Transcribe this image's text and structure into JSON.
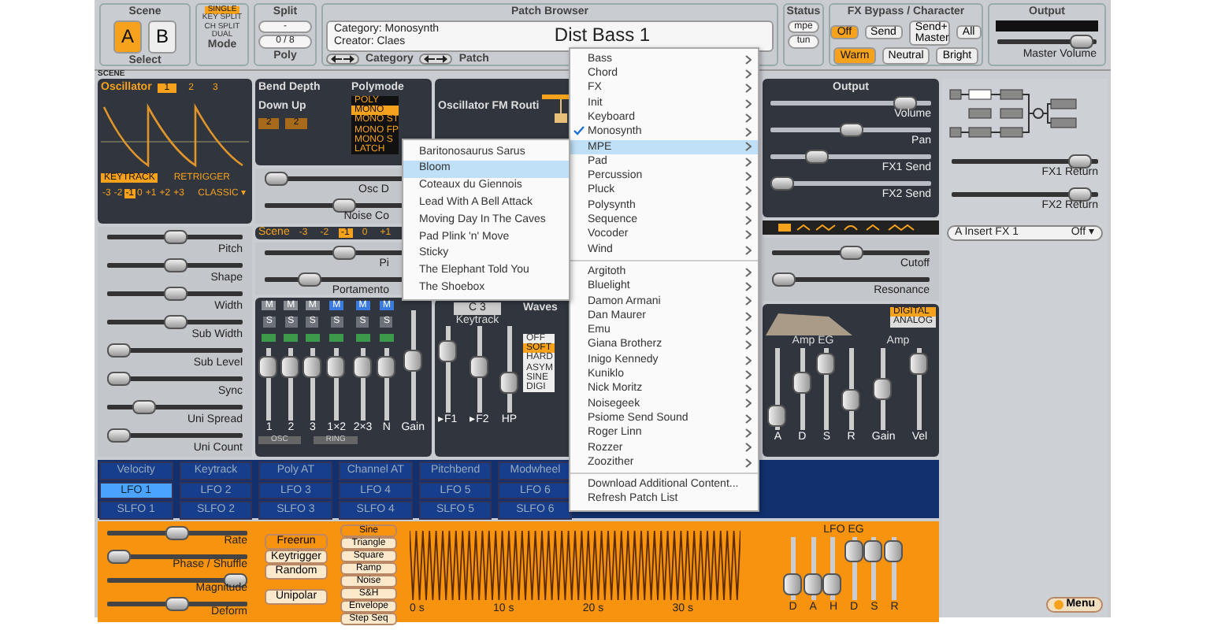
{
  "header": {
    "scene": {
      "title": "Scene",
      "buttons": [
        {
          "label": "A",
          "selected": true
        },
        {
          "label": "B",
          "selected": false
        }
      ],
      "label": "Select"
    },
    "mode": {
      "options": [
        {
          "label": "SINGLE",
          "selected": true
        },
        {
          "label": "KEY SPLIT",
          "selected": false
        },
        {
          "label": "CH SPLIT",
          "selected": false
        },
        {
          "label": "DUAL",
          "selected": false
        }
      ],
      "label": "Mode"
    },
    "split": {
      "title": "Split",
      "value": "-",
      "poly": "0 / 8",
      "label": "Poly"
    },
    "patch_browser": {
      "title": "Patch Browser",
      "category": "Category: Monosynth",
      "creator": "Creator: Claes",
      "patch_name": "Dist Bass 1",
      "category_nav": "Category",
      "patch_nav": "Patch"
    },
    "status": {
      "title": "Status",
      "buttons": [
        "mpe",
        "tun"
      ]
    },
    "fx_bypass": {
      "title": "FX Bypass / Character",
      "buttons": [
        {
          "label": "Off",
          "selected": true
        },
        {
          "label": "Send",
          "selected": false
        },
        {
          "label": "Send+ Master",
          "selected": false
        },
        {
          "label": "All",
          "selected": false
        }
      ],
      "character": [
        {
          "label": "Warm",
          "selected": true
        },
        {
          "label": "Neutral",
          "selected": false
        },
        {
          "label": "Bright",
          "selected": false
        }
      ]
    },
    "output": {
      "title": "Output",
      "master_volume": {
        "label": "Master Volume",
        "level": 0.95
      }
    }
  },
  "scene_label": "SCENE",
  "oscillator": {
    "title": "Oscillator",
    "tabs": [
      {
        "label": "1",
        "selected": true
      },
      {
        "label": "2",
        "selected": false
      },
      {
        "label": "3",
        "selected": false
      }
    ],
    "toggles": [
      {
        "label": "KEYTRACK",
        "on": true
      },
      {
        "label": "RETRIGGER",
        "on": false
      }
    ],
    "octave": [
      {
        "label": "-3",
        "selected": false
      },
      {
        "label": "-2",
        "selected": false
      },
      {
        "label": "-1",
        "selected": true
      },
      {
        "label": "0",
        "selected": false
      },
      {
        "label": "+1",
        "selected": false
      },
      {
        "label": "+2",
        "selected": false
      },
      {
        "label": "+3",
        "selected": false
      }
    ],
    "type": "CLASSIC ▾",
    "sliders": [
      {
        "label": "Pitch",
        "level": 0.5
      },
      {
        "label": "Shape",
        "level": 0.5
      },
      {
        "label": "Width",
        "level": 0.5
      },
      {
        "label": "Sub Width",
        "level": 0.5
      },
      {
        "label": "Sub Level",
        "level": 0
      },
      {
        "label": "Sync",
        "level": 0
      },
      {
        "label": "Uni Spread",
        "level": 0.22
      },
      {
        "label": "Uni Count",
        "level": 0
      }
    ]
  },
  "bend_depth": {
    "title": "Bend Depth",
    "label": "Down Up",
    "values": [
      "2",
      "2"
    ]
  },
  "polymode": {
    "title": "Polymode",
    "options": [
      {
        "label": "POLY",
        "selected": false
      },
      {
        "label": "MONO",
        "selected": true
      },
      {
        "label": "MONO ST",
        "selected": false
      },
      {
        "label": "MONO FP",
        "selected": false
      },
      {
        "label": "MONO S",
        "selected": false
      },
      {
        "label": "LATCH",
        "selected": false
      }
    ]
  },
  "osc_drift": {
    "label": "Osc D",
    "level": 0
  },
  "noise_color": {
    "label": "Noise Co",
    "level": 0.5
  },
  "scene_octave": {
    "title": "Scene",
    "options": [
      {
        "label": "-3",
        "selected": false
      },
      {
        "label": "-2",
        "selected": false
      },
      {
        "label": "-1",
        "selected": true
      },
      {
        "label": "0",
        "selected": false
      },
      {
        "label": "+1",
        "selected": false
      }
    ]
  },
  "scene_pitch": {
    "label": "Pi",
    "level": 0.5
  },
  "portamento": {
    "label": "Portamento",
    "level": 0.25
  },
  "mixer": {
    "channels": [
      {
        "label": "1",
        "mute_label": "M",
        "solo_label": "S",
        "muted": false,
        "level": 0.85
      },
      {
        "label": "2",
        "mute_label": "M",
        "solo_label": "S",
        "muted": false,
        "level": 0.85
      },
      {
        "label": "3",
        "mute_label": "M",
        "solo_label": "S",
        "muted": false,
        "level": 0.85
      },
      {
        "label": "1×2",
        "mute_label": "M",
        "solo_label": "S",
        "muted": true,
        "level": 0.85
      },
      {
        "label": "2×3",
        "mute_label": "M",
        "solo_label": "S",
        "muted": true,
        "level": 0.85
      },
      {
        "label": "N",
        "mute_label": "M",
        "solo_label": "S",
        "muted": true,
        "level": 0.85
      },
      {
        "label": "Gain",
        "level": 0.55
      }
    ],
    "groups": [
      "OSC",
      "RING"
    ]
  },
  "filter": {
    "fm_title": "Oscillator FM Routi",
    "note": "C 3",
    "keytrack": "Keytrack",
    "sliders": [
      {
        "label": "▸F1",
        "level": 0.8
      },
      {
        "label": "▸F2",
        "level": 0.55
      },
      {
        "label": "HP",
        "level": 0.3
      }
    ],
    "waveshaper": {
      "title": "Waves",
      "options": [
        {
          "label": "OFF",
          "selected": false
        },
        {
          "label": "SOFT",
          "selected": true
        },
        {
          "label": "HARD",
          "selected": false
        },
        {
          "label": "ASYM",
          "selected": false
        },
        {
          "label": "SINE",
          "selected": false
        },
        {
          "label": "DIGI",
          "selected": false
        }
      ]
    }
  },
  "output_panel": {
    "title": "Output",
    "sliders": [
      {
        "label": "Volume",
        "level": 0.9
      },
      {
        "label": "Pan",
        "level": 0.5
      },
      {
        "label": "FX1 Send",
        "level": 0.25
      },
      {
        "label": "FX2 Send",
        "level": 0
      }
    ]
  },
  "filter_controls": {
    "sliders": [
      {
        "label": "Cutoff",
        "level": 0.5
      },
      {
        "label": "Resonance",
        "level": 0
      }
    ]
  },
  "amp_eg": {
    "title": "Amp EG",
    "amp_title": "Amp",
    "modes": [
      {
        "label": "DIGITAL",
        "selected": true
      },
      {
        "label": "ANALOG",
        "selected": false
      }
    ],
    "sliders": [
      {
        "label": "A",
        "level": 0.05
      },
      {
        "label": "D",
        "level": 0.6
      },
      {
        "label": "S",
        "level": 0.92
      },
      {
        "label": "R",
        "level": 0.3
      },
      {
        "label": "Gain",
        "level": 0.5
      },
      {
        "label": "Vel",
        "level": 0.92
      }
    ]
  },
  "fx_panel": {
    "returns": [
      {
        "label": "FX1 Return",
        "level": 0.95
      },
      {
        "label": "FX2 Return",
        "level": 0.95
      }
    ],
    "insert": {
      "label": "A Insert FX 1",
      "value": "Off ▾"
    }
  },
  "modulation": {
    "rows": [
      [
        {
          "label": "Velocity",
          "selected": false
        },
        {
          "label": "Keytrack",
          "selected": false
        },
        {
          "label": "Poly AT",
          "selected": false
        },
        {
          "label": "Channel AT",
          "selected": false
        },
        {
          "label": "Pitchbend",
          "selected": false
        },
        {
          "label": "Modwheel",
          "selected": false
        }
      ],
      [
        {
          "label": "LFO 1",
          "selected": true
        },
        {
          "label": "LFO 2",
          "selected": false
        },
        {
          "label": "LFO 3",
          "selected": false
        },
        {
          "label": "LFO 4",
          "selected": false
        },
        {
          "label": "LFO 5",
          "selected": false
        },
        {
          "label": "LFO 6",
          "selected": false
        }
      ],
      [
        {
          "label": "SLFO 1",
          "selected": false
        },
        {
          "label": "SLFO 2",
          "selected": false
        },
        {
          "label": "SLFO 3",
          "selected": false
        },
        {
          "label": "SLFO 4",
          "selected": false
        },
        {
          "label": "SLFO 5",
          "selected": false
        },
        {
          "label": "SLFO 6",
          "selected": false
        }
      ]
    ]
  },
  "lfo": {
    "sliders": [
      {
        "label": "Rate",
        "level": 0.5
      },
      {
        "label": "Phase / Shuffle",
        "level": 0
      },
      {
        "label": "Magnitude",
        "level": 1
      },
      {
        "label": "Deform",
        "level": 0.5
      }
    ],
    "triggers": [
      {
        "label": "Freerun",
        "selected": true
      },
      {
        "label": "Keytrigger",
        "selected": false
      },
      {
        "label": "Random",
        "selected": false
      }
    ],
    "unipolar": {
      "label": "Unipolar",
      "on": false
    },
    "shapes": [
      {
        "label": "Sine",
        "selected": true
      },
      {
        "label": "Triangle",
        "selected": false
      },
      {
        "label": "Square",
        "selected": false
      },
      {
        "label": "Ramp",
        "selected": false
      },
      {
        "label": "Noise",
        "selected": false
      },
      {
        "label": "S&H",
        "selected": false
      },
      {
        "label": "Envelope",
        "selected": false
      },
      {
        "label": "Step Seq",
        "selected": false
      }
    ],
    "time_ticks": [
      "0 s",
      "10 s",
      "20 s",
      "30 s"
    ],
    "eg": {
      "title": "LFO EG",
      "sliders": [
        {
          "label": "D",
          "level": 0.1
        },
        {
          "label": "A",
          "level": 0.1
        },
        {
          "label": "H",
          "level": 0.1
        },
        {
          "label": "D",
          "level": 0.9
        },
        {
          "label": "S",
          "level": 0.9
        },
        {
          "label": "R",
          "level": 0.9
        }
      ]
    }
  },
  "menu_button": "Menu",
  "category_menu": {
    "sections": [
      [
        {
          "label": "Bass",
          "checked": false,
          "selected": false,
          "submenu": true
        },
        {
          "label": "Chord",
          "checked": false,
          "selected": false,
          "submenu": true
        },
        {
          "label": "FX",
          "checked": false,
          "selected": false,
          "submenu": true
        },
        {
          "label": "Init",
          "checked": false,
          "selected": false,
          "submenu": true
        },
        {
          "label": "Keyboard",
          "checked": false,
          "selected": false,
          "submenu": true
        },
        {
          "label": "Monosynth",
          "checked": true,
          "selected": false,
          "submenu": true
        },
        {
          "label": "MPE",
          "checked": false,
          "selected": true,
          "submenu": true
        },
        {
          "label": "Pad",
          "checked": false,
          "selected": false,
          "submenu": true
        },
        {
          "label": "Percussion",
          "checked": false,
          "selected": false,
          "submenu": true
        },
        {
          "label": "Pluck",
          "checked": false,
          "selected": false,
          "submenu": true
        },
        {
          "label": "Polysynth",
          "checked": false,
          "selected": false,
          "submenu": true
        },
        {
          "label": "Sequence",
          "checked": false,
          "selected": false,
          "submenu": true
        },
        {
          "label": "Vocoder",
          "checked": false,
          "selected": false,
          "submenu": true
        },
        {
          "label": "Wind",
          "checked": false,
          "selected": false,
          "submenu": true
        }
      ],
      [
        {
          "label": "Argitoth",
          "checked": false,
          "selected": false,
          "submenu": true
        },
        {
          "label": "Bluelight",
          "checked": false,
          "selected": false,
          "submenu": true
        },
        {
          "label": "Damon Armani",
          "checked": false,
          "selected": false,
          "submenu": true
        },
        {
          "label": "Dan Maurer",
          "checked": false,
          "selected": false,
          "submenu": true
        },
        {
          "label": "Emu",
          "checked": false,
          "selected": false,
          "submenu": true
        },
        {
          "label": "Giana Brotherz",
          "checked": false,
          "selected": false,
          "submenu": true
        },
        {
          "label": "Inigo Kennedy",
          "checked": false,
          "selected": false,
          "submenu": true
        },
        {
          "label": "Kuniklo",
          "checked": false,
          "selected": false,
          "submenu": true
        },
        {
          "label": "Nick Moritz",
          "checked": false,
          "selected": false,
          "submenu": true
        },
        {
          "label": "Noisegeek",
          "checked": false,
          "selected": false,
          "submenu": true
        },
        {
          "label": "Psiome Send Sound",
          "checked": false,
          "selected": false,
          "submenu": true
        },
        {
          "label": "Roger Linn",
          "checked": false,
          "selected": false,
          "submenu": true
        },
        {
          "label": "Rozzer",
          "checked": false,
          "selected": false,
          "submenu": true
        },
        {
          "label": "Zoozither",
          "checked": false,
          "selected": false,
          "submenu": true
        }
      ],
      [
        {
          "label": "Download Additional Content...",
          "checked": false,
          "selected": false,
          "submenu": false
        },
        {
          "label": "Refresh Patch List",
          "checked": false,
          "selected": false,
          "submenu": false
        }
      ]
    ]
  },
  "patch_menu": {
    "items": [
      {
        "label": "Baritonosaurus Sarus",
        "selected": false
      },
      {
        "label": "Bloom",
        "selected": true
      },
      {
        "label": "Coteaux du Giennois",
        "selected": false
      },
      {
        "label": "Lead With A Bell Attack",
        "selected": false
      },
      {
        "label": "Moving Day In The Caves",
        "selected": false
      },
      {
        "label": "Pad Plink 'n' Move",
        "selected": false
      },
      {
        "label": "Sticky",
        "selected": false
      },
      {
        "label": "The Elephant Told You",
        "selected": false
      },
      {
        "label": "The Shoebox",
        "selected": false
      }
    ]
  }
}
